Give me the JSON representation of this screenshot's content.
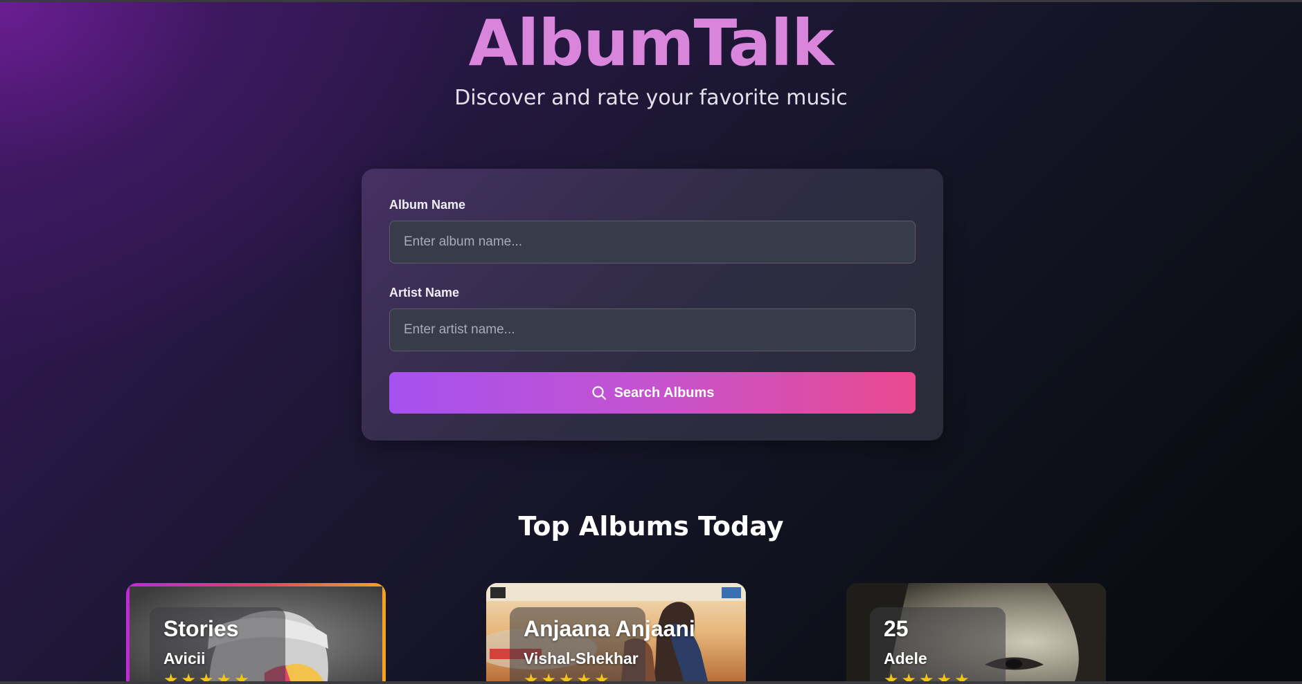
{
  "header": {
    "title": "AlbumTalk",
    "subtitle": "Discover and rate your favorite music"
  },
  "search_form": {
    "album_label": "Album Name",
    "album_placeholder": "Enter album name...",
    "album_value": "",
    "artist_label": "Artist Name",
    "artist_placeholder": "Enter artist name...",
    "artist_value": "",
    "button_label": "Search Albums",
    "button_icon": "search-icon"
  },
  "top_albums": {
    "section_title": "Top Albums Today",
    "items": [
      {
        "title": "Stories",
        "artist": "Avicii",
        "rating": 5,
        "stars": "★★★★★"
      },
      {
        "title": "Anjaana Anjaani",
        "artist": "Vishal-Shekhar",
        "rating": 5,
        "stars": "★★★★★"
      },
      {
        "title": "25",
        "artist": "Adele",
        "rating": 5,
        "stars": "★★★★★"
      }
    ]
  },
  "colors": {
    "brand_title": "#d985dc",
    "button_gradient_start": "#a651ef",
    "button_gradient_end": "#ea4a8f",
    "star": "#f5c518"
  }
}
